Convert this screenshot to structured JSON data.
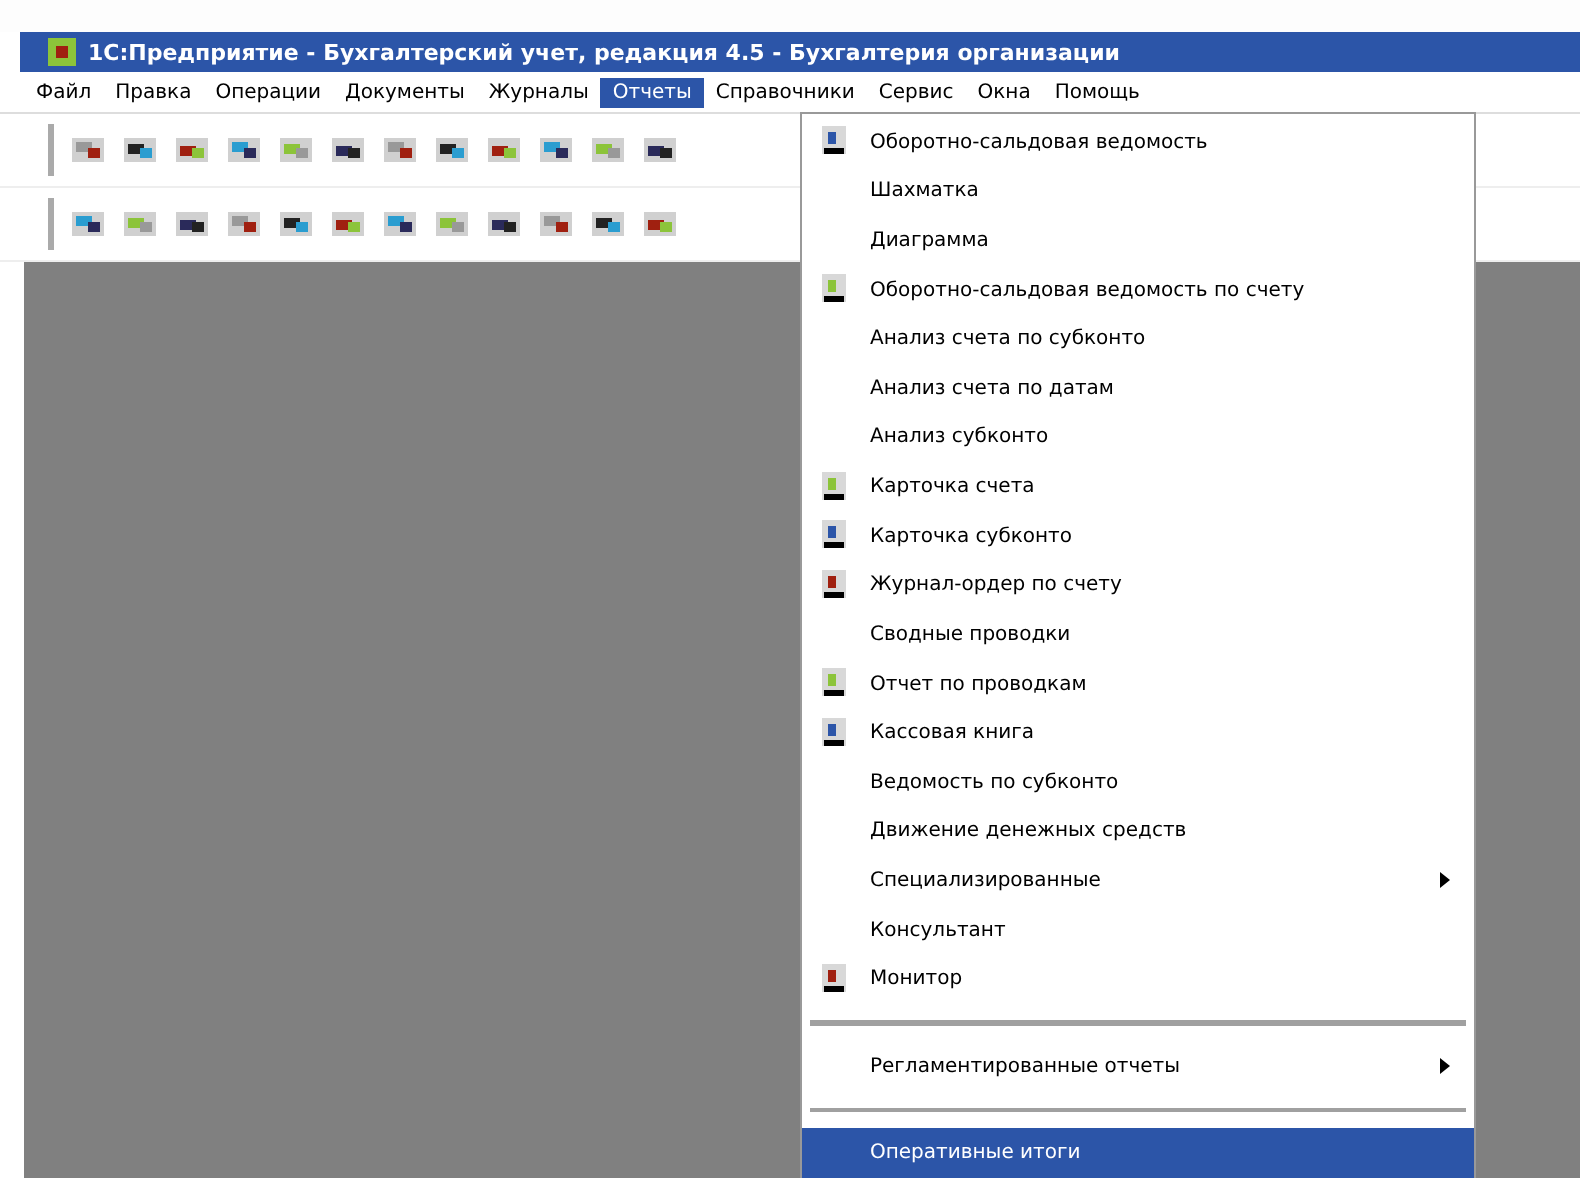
{
  "window": {
    "title": "1С:Предприятие - Бухгалтерский учет, редакция 4.5 - Бухгалтерия организации"
  },
  "menu_bar": [
    {
      "label": "Файл",
      "selected": false
    },
    {
      "label": "Правка",
      "selected": false
    },
    {
      "label": "Операции",
      "selected": false
    },
    {
      "label": "Документы",
      "selected": false
    },
    {
      "label": "Журналы",
      "selected": false
    },
    {
      "label": "Отчеты",
      "selected": true
    },
    {
      "label": "Справочники",
      "selected": false
    },
    {
      "label": "Сервис",
      "selected": false
    },
    {
      "label": "Окна",
      "selected": false
    },
    {
      "label": "Помощь",
      "selected": false
    }
  ],
  "dropdown": [
    {
      "kind": "item",
      "label": "Оборотно-сальдовая ведомость",
      "icon": true,
      "selected": false
    },
    {
      "kind": "item",
      "label": "Шахматка",
      "icon": false,
      "selected": false
    },
    {
      "kind": "item",
      "label": "Диаграмма",
      "icon": false,
      "selected": false
    },
    {
      "kind": "item",
      "label": "Оборотно-сальдовая ведомость по счету",
      "icon": true,
      "selected": false
    },
    {
      "kind": "item",
      "label": "Анализ счета по субконто",
      "icon": false,
      "selected": false
    },
    {
      "kind": "item",
      "label": "Анализ счета по датам",
      "icon": false,
      "selected": false
    },
    {
      "kind": "item",
      "label": "Анализ субконто",
      "icon": false,
      "selected": false
    },
    {
      "kind": "item",
      "label": "Карточка счета",
      "icon": true,
      "selected": false
    },
    {
      "kind": "item",
      "label": "Карточка субконто",
      "icon": true,
      "selected": false
    },
    {
      "kind": "item",
      "label": "Журнал-ордер по счету",
      "icon": true,
      "selected": false
    },
    {
      "kind": "item",
      "label": "Сводные проводки",
      "icon": false,
      "selected": false
    },
    {
      "kind": "item",
      "label": "Отчет по проводкам",
      "icon": true,
      "selected": false
    },
    {
      "kind": "item",
      "label": "Кассовая книга",
      "icon": true,
      "selected": false
    },
    {
      "kind": "item",
      "label": "Ведомость по субконто",
      "icon": false,
      "selected": false
    },
    {
      "kind": "item",
      "label": "Движение денежных средств",
      "icon": false,
      "selected": false
    },
    {
      "kind": "submenu",
      "label": "Специализированные",
      "icon": false,
      "selected": false
    },
    {
      "kind": "item",
      "label": "Консультант",
      "icon": false,
      "selected": false
    },
    {
      "kind": "item",
      "label": "Монитор",
      "icon": true,
      "selected": false
    },
    {
      "kind": "separator"
    },
    {
      "kind": "submenu",
      "label": "Регламентированные отчеты",
      "icon": false,
      "selected": false
    },
    {
      "kind": "separator"
    },
    {
      "kind": "item",
      "label": "Оперативные итоги",
      "icon": false,
      "selected": true
    }
  ]
}
